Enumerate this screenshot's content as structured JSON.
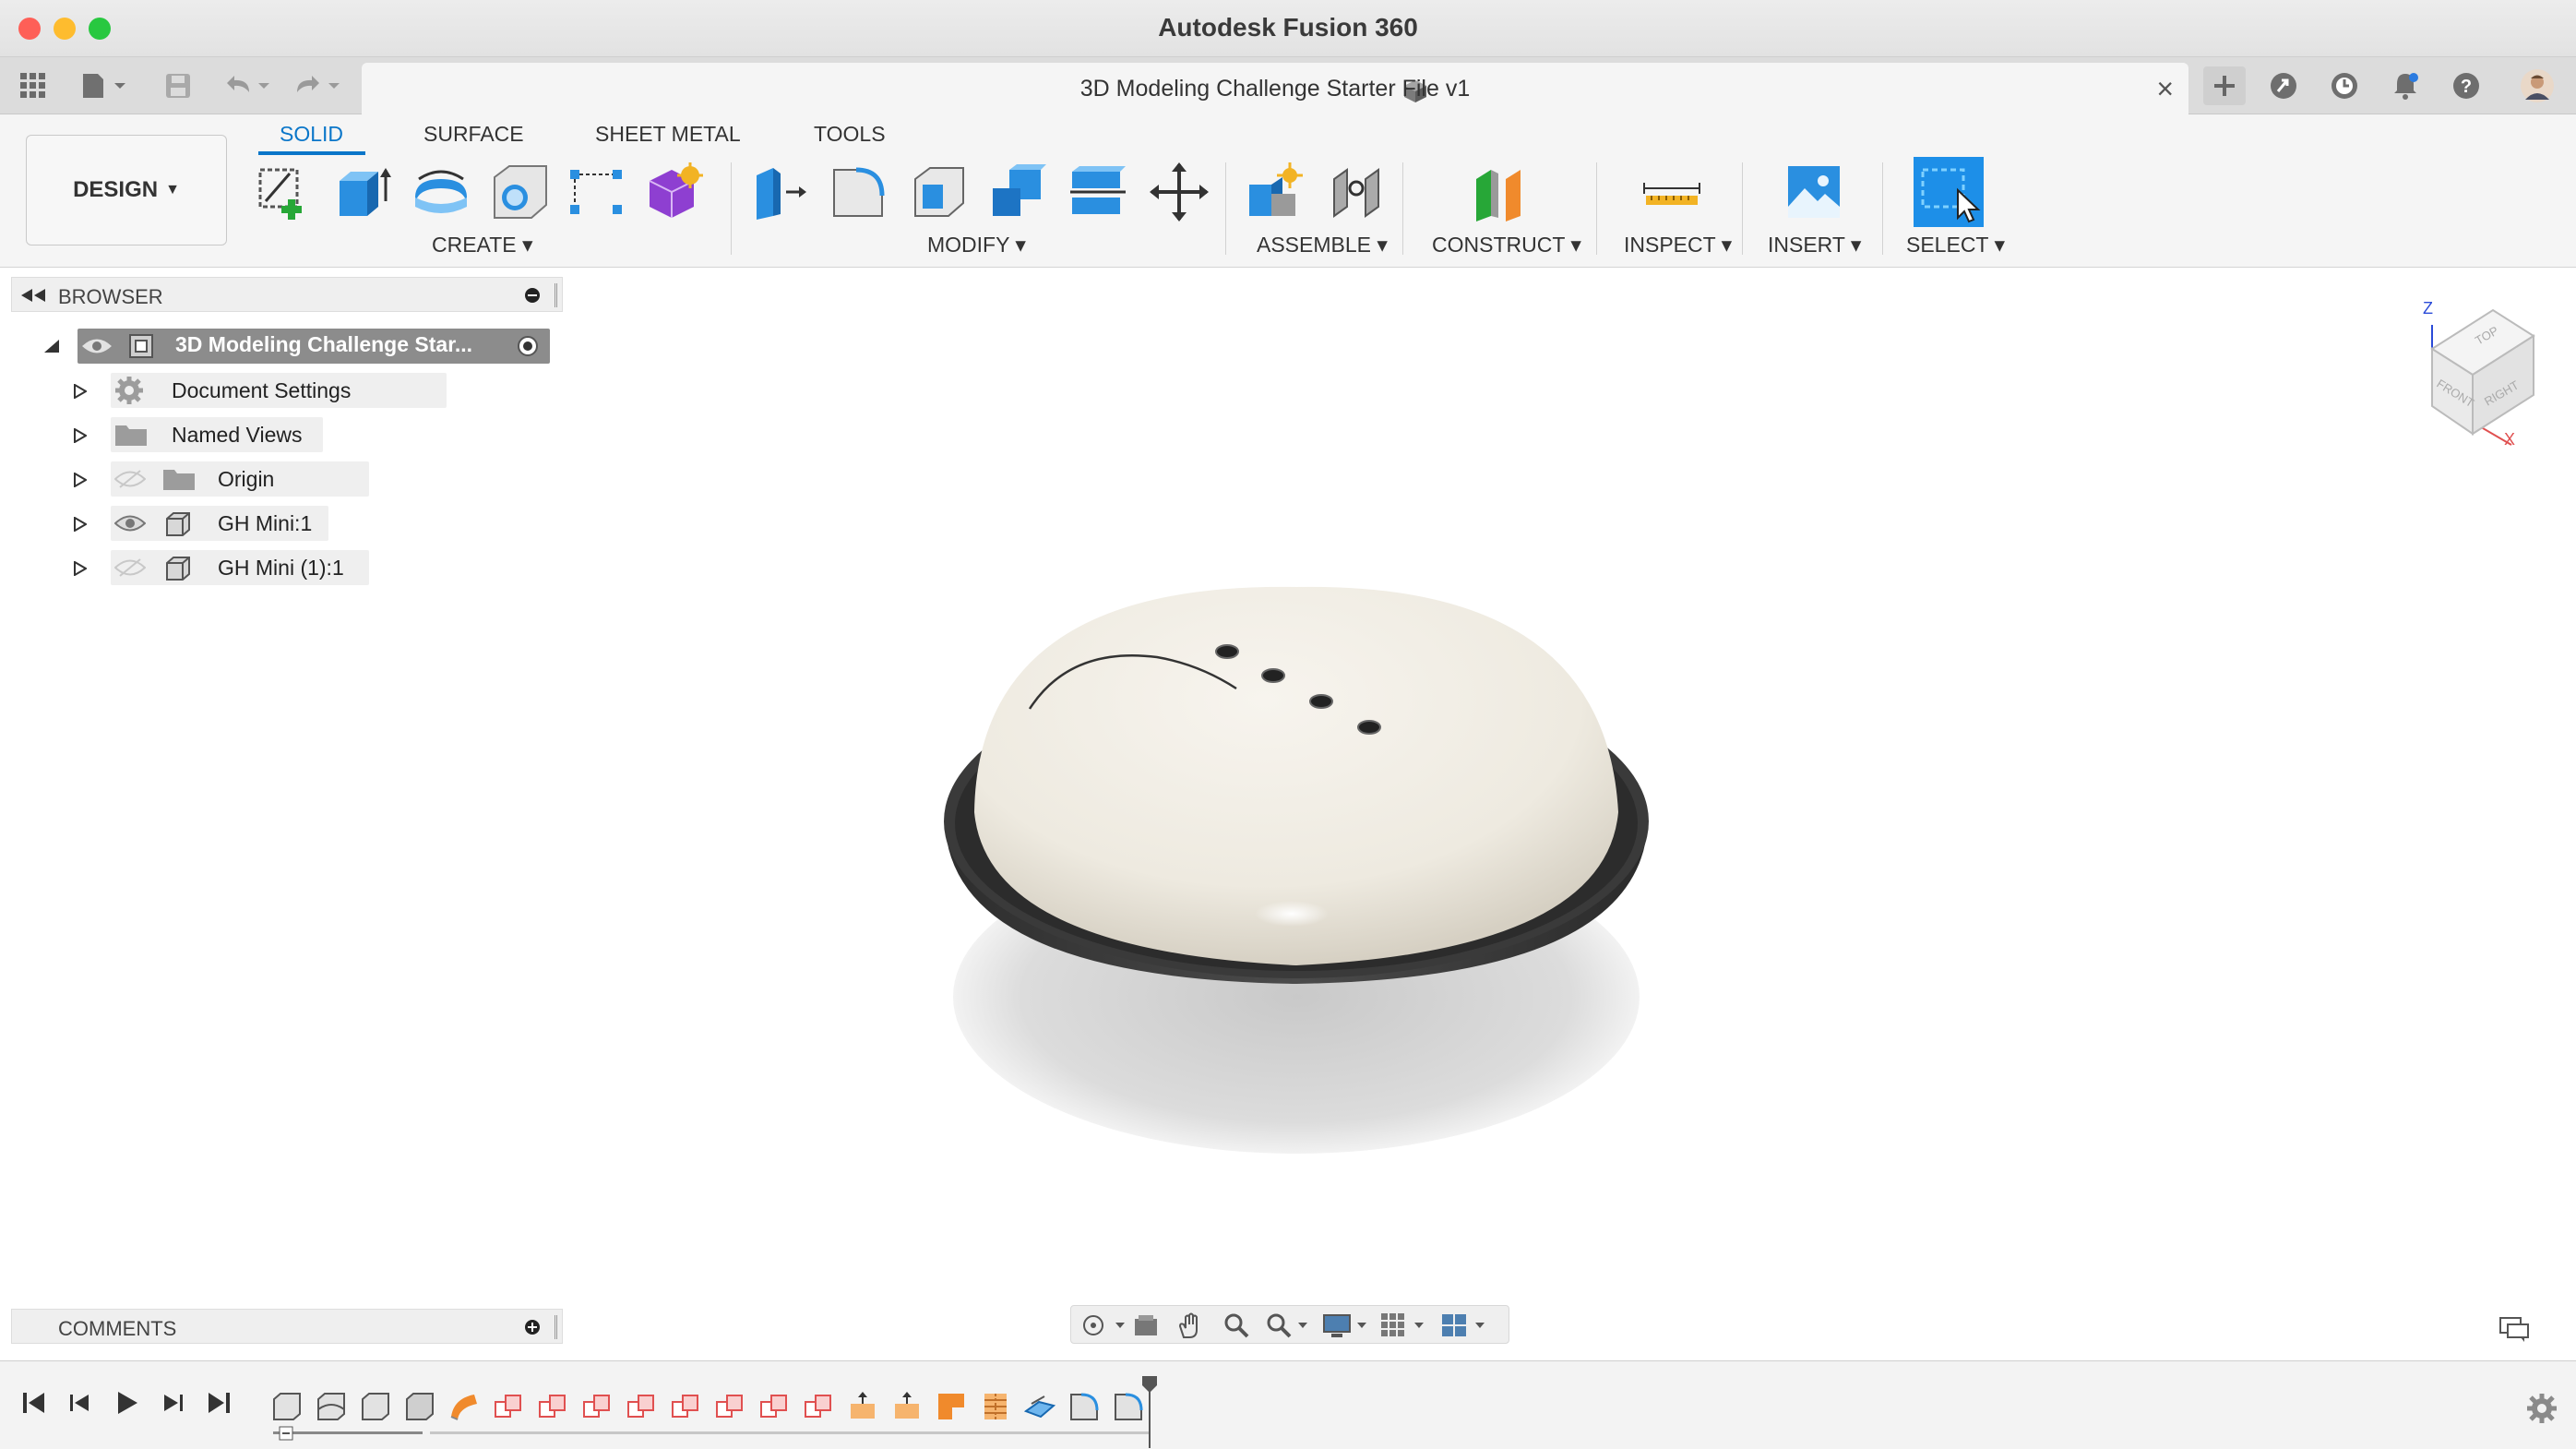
{
  "window": {
    "title": "Autodesk Fusion 360"
  },
  "document_tab": {
    "title": "3D Modeling Challenge Starter File v1"
  },
  "workspace": {
    "label": "DESIGN"
  },
  "toolbar_tabs": [
    "SOLID",
    "SURFACE",
    "SHEET METAL",
    "TOOLS"
  ],
  "groups": {
    "create": "CREATE",
    "modify": "MODIFY",
    "assemble": "ASSEMBLE",
    "construct": "CONSTRUCT",
    "inspect": "INSPECT",
    "insert": "INSERT",
    "select": "SELECT"
  },
  "browser": {
    "title": "BROWSER",
    "root": "3D Modeling Challenge Star...",
    "items": [
      "Document Settings",
      "Named Views",
      "Origin",
      "GH Mini:1",
      "GH Mini (1):1"
    ]
  },
  "comments": {
    "title": "COMMENTS"
  },
  "viewcube": {
    "faces": [
      "TOP",
      "FRONT",
      "RIGHT"
    ],
    "axes": [
      "Z",
      "X"
    ]
  },
  "colors": {
    "accent": "#0a76c9",
    "selected_row": "#7a7a7a",
    "model_top": "#efebe2",
    "model_shell": "#3b3b3b"
  }
}
